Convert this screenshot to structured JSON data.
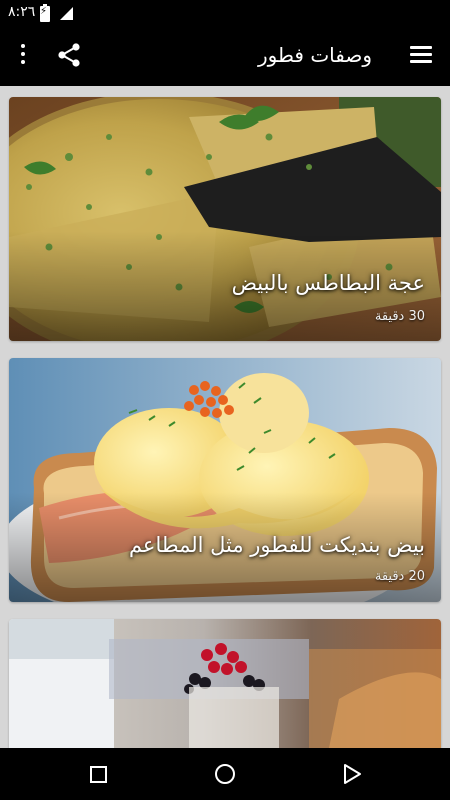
{
  "status_bar": {
    "time": "٨:٢٦",
    "battery_icon": "battery-charging-icon",
    "signal_icon": "signal-icon"
  },
  "app_bar": {
    "title": "وصفات فطور",
    "menu_icon": "hamburger-menu-icon",
    "share_icon": "share-icon",
    "more_icon": "more-vert-icon"
  },
  "recipes": [
    {
      "title": "عجة البطاطس بالبيض",
      "time": "30 دقيقة",
      "image": "potato-egg-frittata"
    },
    {
      "title": "بيض بنديكت للفطور مثل المطاعم",
      "time": "20 دقيقة",
      "image": "eggs-benedict"
    },
    {
      "title": "",
      "time": "",
      "image": "berries-and-milk"
    }
  ],
  "nav_bar": {
    "recents_icon": "recents-square-icon",
    "home_icon": "home-circle-icon",
    "back_icon": "back-triangle-icon"
  },
  "colors": {
    "bars": "#000000",
    "background": "#d6d6d6",
    "text_on_bar": "#ffffff"
  }
}
